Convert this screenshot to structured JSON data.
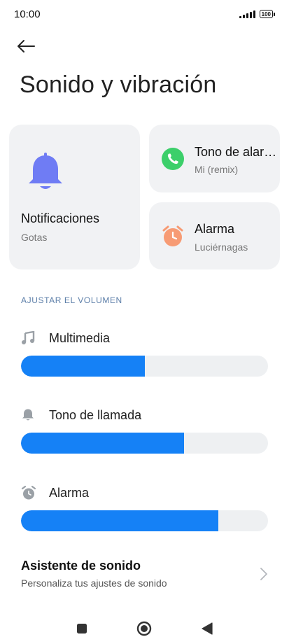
{
  "status_bar": {
    "time": "10:00",
    "battery_level": "100"
  },
  "header": {
    "title": "Sonido y vibración",
    "back_icon": "arrow-left-icon"
  },
  "cards": {
    "notifications": {
      "title": "Notificaciones",
      "subtitle": "Gotas",
      "icon": "bell-icon",
      "icon_color": "#6f7cf4"
    },
    "ringtone": {
      "title": "Tono de alarma",
      "subtitle": "Mi (remix)",
      "icon": "phone-icon",
      "icon_color": "#3ccf6a"
    },
    "alarm": {
      "title": "Alarma",
      "subtitle": "Luciérnagas",
      "icon": "alarm-clock-icon",
      "icon_color": "#f79b74"
    }
  },
  "volume": {
    "section_label": "AJUSTAR EL VOLUMEN",
    "accent_color": "#1581f6",
    "track_color": "#eef0f2",
    "items": [
      {
        "label": "Multimedia",
        "icon": "music-note-icon",
        "level_percent": 50
      },
      {
        "label": "Tono de llamada",
        "icon": "bell-small-icon",
        "level_percent": 66
      },
      {
        "label": "Alarma",
        "icon": "alarm-small-icon",
        "level_percent": 80
      }
    ]
  },
  "assistant": {
    "title": "Asistente de sonido",
    "subtitle": "Personaliza tus ajustes de sonido",
    "icon": "chevron-right-icon"
  },
  "nav": {
    "recents_icon": "square-icon",
    "home_icon": "circle-icon",
    "back_icon": "triangle-back-icon"
  }
}
